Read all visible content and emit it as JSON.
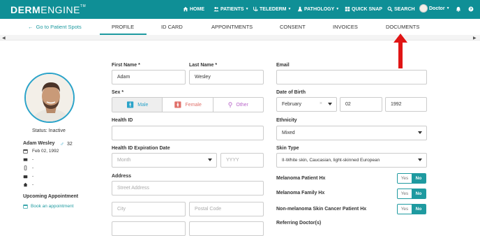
{
  "brand": {
    "derm": "DERM",
    "engine": "ENGINE",
    "tm": "TM"
  },
  "nav": {
    "home": "HOME",
    "patients": "PATIENTS",
    "telederm": "TELEDERM",
    "pathology": "PATHOLOGY",
    "quick_snap": "QUICK SNAP",
    "search": "SEARCH",
    "user": "Doctor"
  },
  "tabs": {
    "back": "Go to Patient Spots",
    "profile": "PROFILE",
    "id_card": "ID CARD",
    "appointments": "APPOINTMENTS",
    "consent": "CONSENT",
    "invoices": "INVOICES",
    "documents": "DOCUMENTS"
  },
  "patient": {
    "status": "Status: Inactive",
    "name": "Adam Wesley",
    "age": "32",
    "dob": "Feb 02, 1992",
    "email": "-",
    "phone": "-",
    "work": "-",
    "home": "-",
    "upcoming_label": "Upcoming Appointment",
    "book_link": "Book an appointment"
  },
  "form": {
    "first_name_label": "First Name *",
    "first_name": "Adam",
    "last_name_label": "Last Name *",
    "last_name": "Wesley",
    "email_label": "Email",
    "email": "",
    "sex_label": "Sex *",
    "sex_options": [
      "Male",
      "Female",
      "Other"
    ],
    "dob_label": "Date of Birth",
    "dob_month": "February",
    "dob_day": "02",
    "dob_year": "1992",
    "health_id_label": "Health ID",
    "ethnicity_label": "Ethnicity",
    "ethnicity": "Mixed",
    "health_exp_label": "Health ID Expiration Date",
    "month_placeholder": "Month",
    "year_placeholder": "YYYY",
    "skin_type_label": "Skin Type",
    "skin_type": "II-White skin, Caucasian, light-skinned European",
    "address_label": "Address",
    "street_placeholder": "Street Address",
    "city_placeholder": "City",
    "postal_placeholder": "Postal Code",
    "melanoma_hx_label": "Melanoma Patient Hx",
    "melanoma_family_label": "Melanoma Family Hx",
    "nonmelanoma_label": "Non-melanoma Skin Cancer Patient Hx",
    "referring_label": "Referring Doctor(s)",
    "yes": "Yes",
    "no": "No"
  },
  "colors": {
    "brand": "#0f8f96",
    "accent": "#1e9aa0",
    "arrow": "#e01515",
    "male": "#2aa3c9",
    "female": "#e0706a",
    "other": "#b865c9"
  }
}
